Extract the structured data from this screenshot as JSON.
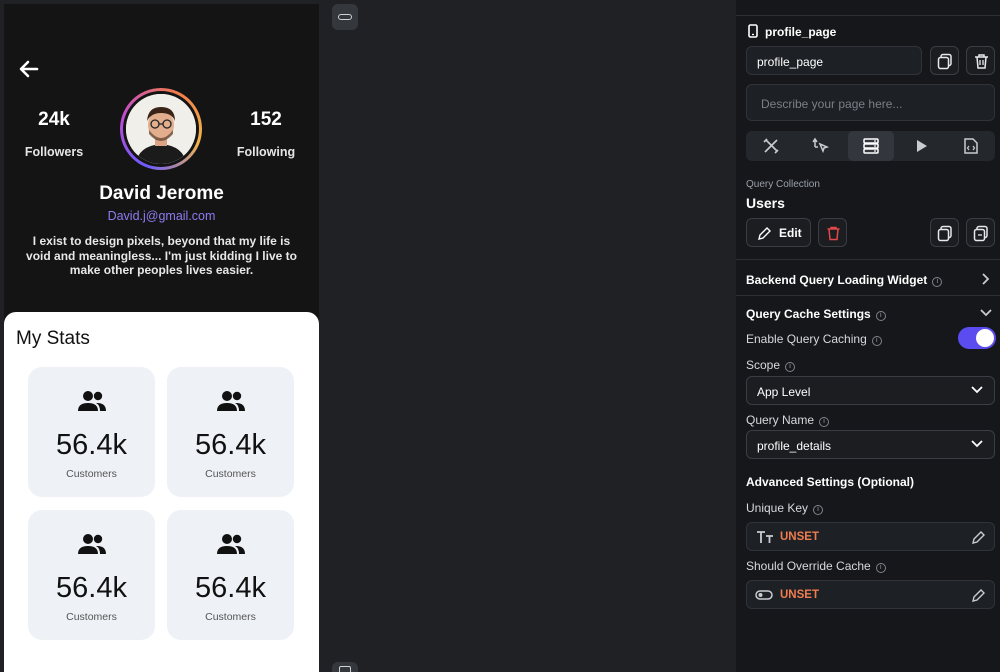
{
  "profile": {
    "followers_count": "24k",
    "followers_label": "Followers",
    "following_count": "152",
    "following_label": "Following",
    "name": "David Jerome",
    "email": "David.j@gmail.com",
    "bio": "I exist to design pixels, beyond that my life is void and meaningless... I'm just kidding I live to make other peoples lives easier."
  },
  "stats": {
    "title": "My Stats",
    "cards": [
      {
        "value": "56.4k",
        "label": "Customers"
      },
      {
        "value": "56.4k",
        "label": "Customers"
      },
      {
        "value": "56.4k",
        "label": "Customers"
      },
      {
        "value": "56.4k",
        "label": "Customers"
      }
    ]
  },
  "panel": {
    "page_header": "profile_page",
    "page_name_value": "profile_page",
    "description_placeholder": "Describe your page here...",
    "query_collection_label": "Query Collection",
    "query_collection_value": "Users",
    "edit_label": "Edit",
    "backend_loading_label": "Backend Query Loading Widget",
    "cache_settings_label": "Query Cache Settings",
    "enable_caching_label": "Enable Query Caching",
    "enable_caching_on": true,
    "scope_label": "Scope",
    "scope_value": "App Level",
    "query_name_label": "Query Name",
    "query_name_value": "profile_details",
    "advanced_label": "Advanced Settings (Optional)",
    "unique_key_label": "Unique Key",
    "unique_key_value": "UNSET",
    "override_cache_label": "Should Override Cache",
    "override_cache_value": "UNSET"
  },
  "colors": {
    "accent": "#5b4cf0",
    "unset": "#ef7d4e",
    "email": "#8e7cf0"
  }
}
